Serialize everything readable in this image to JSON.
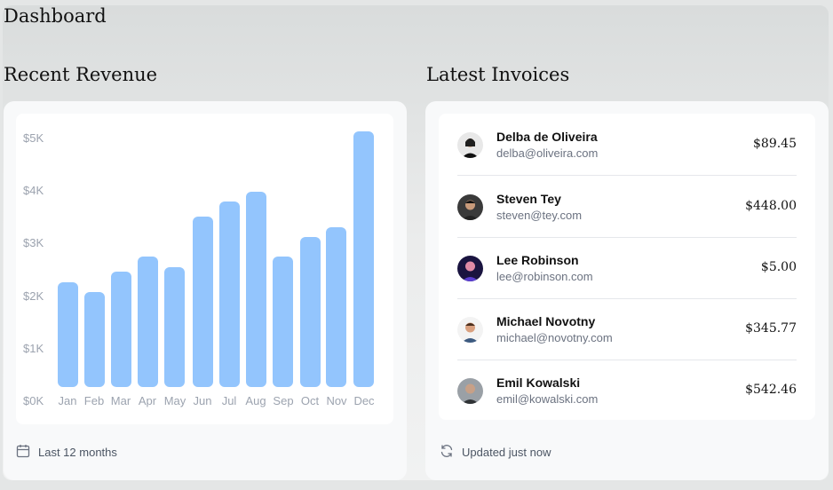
{
  "page": {
    "title": "Dashboard"
  },
  "revenue": {
    "title": "Recent Revenue",
    "footer_label": "Last 12 months",
    "footer_icon": "calendar-icon"
  },
  "chart_data": {
    "type": "bar",
    "categories": [
      "Jan",
      "Feb",
      "Mar",
      "Apr",
      "May",
      "Jun",
      "Jul",
      "Aug",
      "Sep",
      "Oct",
      "Nov",
      "Dec"
    ],
    "values": [
      2100,
      1900,
      2300,
      2600,
      2400,
      3400,
      3700,
      3900,
      2600,
      3000,
      3200,
      5100
    ],
    "ylim": [
      0,
      5000
    ],
    "yticks": [
      "$0K",
      "$1K",
      "$2K",
      "$3K",
      "$4K",
      "$5K"
    ],
    "color": "#93c5fd",
    "grid": false
  },
  "invoices": {
    "title": "Latest Invoices",
    "footer_label": "Updated just now",
    "footer_icon": "refresh-icon",
    "items": [
      {
        "name": "Delba de Oliveira",
        "email": "delba@oliveira.com",
        "amount": "$89.45"
      },
      {
        "name": "Steven Tey",
        "email": "steven@tey.com",
        "amount": "$448.00"
      },
      {
        "name": "Lee Robinson",
        "email": "lee@robinson.com",
        "amount": "$5.00"
      },
      {
        "name": "Michael Novotny",
        "email": "michael@novotny.com",
        "amount": "$345.77"
      },
      {
        "name": "Emil Kowalski",
        "email": "emil@kowalski.com",
        "amount": "$542.46"
      }
    ]
  }
}
